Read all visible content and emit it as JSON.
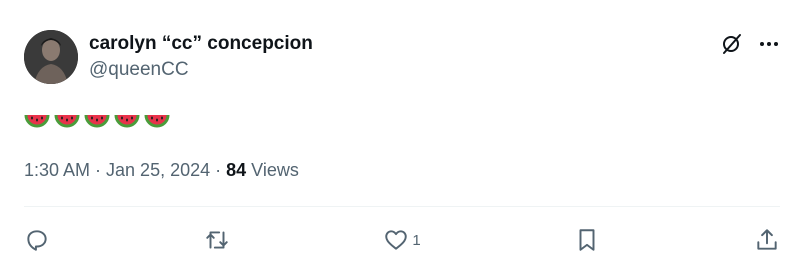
{
  "post": {
    "author_name": "carolyn “cc” concepcion",
    "author_handle": "@queenCC",
    "body_emojis": [
      "🍉",
      "🍉",
      "🍉",
      "🍉",
      "🍉"
    ],
    "timestamp": "1:30 AM · Jan 25, 2024",
    "separator": " · ",
    "views_count": "84",
    "views_label": " Views"
  },
  "top_icons": [
    "grok-slash-icon",
    "more-icon"
  ],
  "actions": {
    "reply": {
      "icon": "reply-icon"
    },
    "repost": {
      "icon": "repost-icon"
    },
    "like": {
      "icon": "heart-icon",
      "count": "1"
    },
    "bookmark": {
      "icon": "bookmark-icon"
    },
    "share": {
      "icon": "share-icon"
    }
  },
  "colors": {
    "text_primary": "#0f1419",
    "text_secondary": "#536471",
    "divider": "#eff3f4",
    "melon_rind": "#4a9c3a",
    "melon_flesh": "#e8324a"
  }
}
